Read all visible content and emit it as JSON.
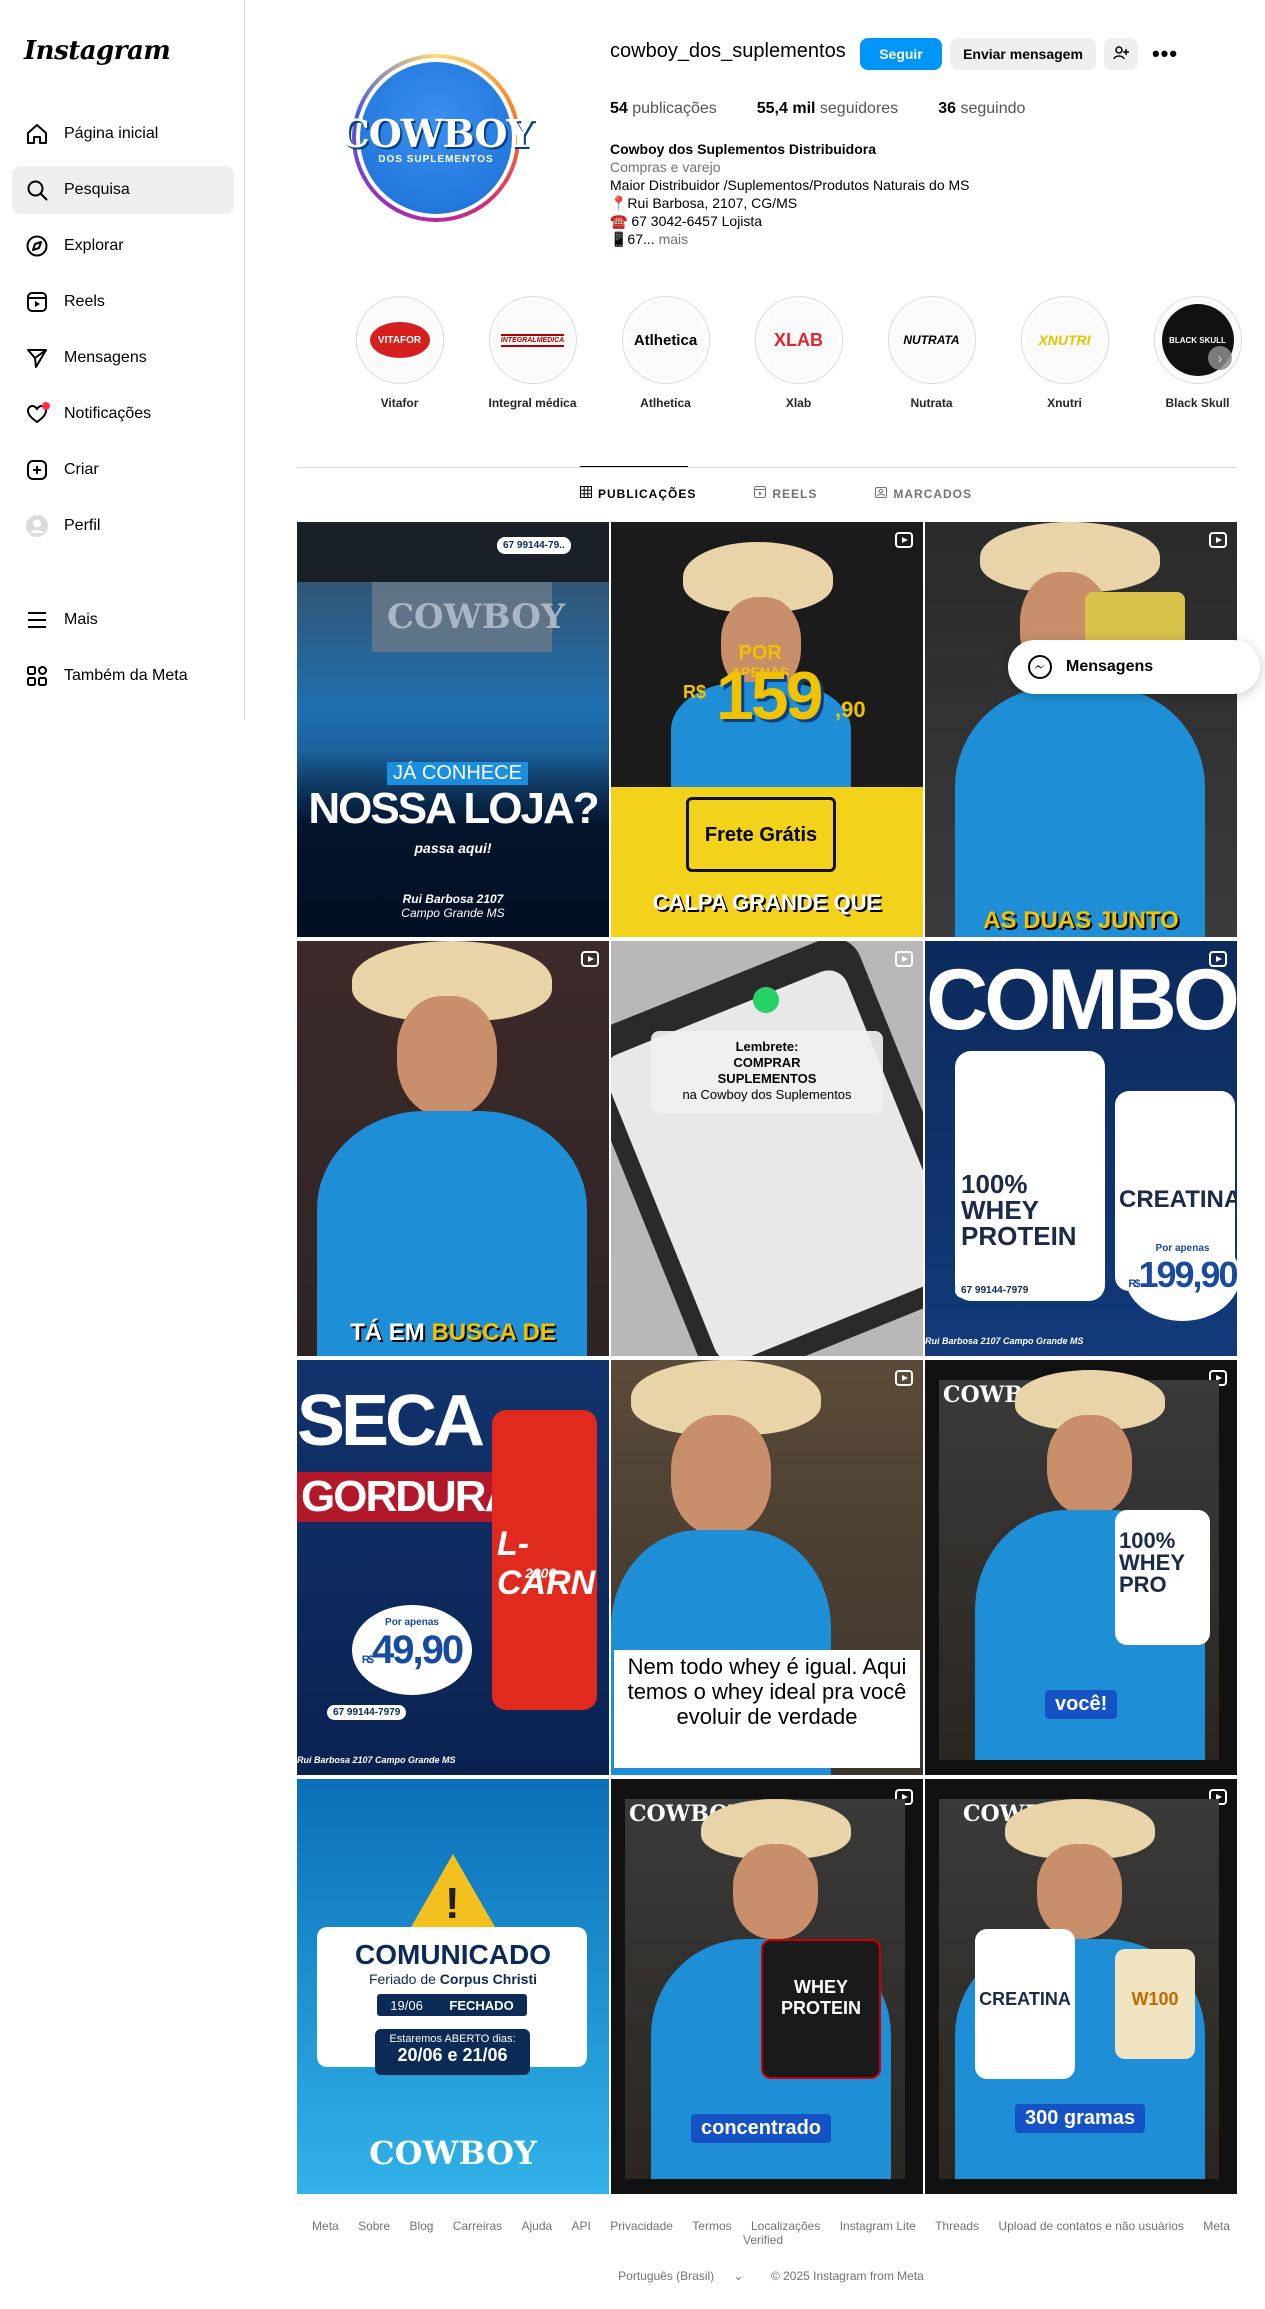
{
  "app": {
    "logo": "Instagram"
  },
  "sidebar": {
    "items": [
      {
        "label": "Página inicial",
        "icon": "home-icon"
      },
      {
        "label": "Pesquisa",
        "icon": "search-icon"
      },
      {
        "label": "Explorar",
        "icon": "compass-icon"
      },
      {
        "label": "Reels",
        "icon": "reels-icon"
      },
      {
        "label": "Mensagens",
        "icon": "send-icon"
      },
      {
        "label": "Notificações",
        "icon": "heart-icon"
      },
      {
        "label": "Criar",
        "icon": "plus-square-icon"
      },
      {
        "label": "Perfil",
        "icon": "profile-avatar-icon"
      }
    ],
    "bottom": [
      {
        "label": "Mais",
        "icon": "menu-icon"
      },
      {
        "label": "Também da Meta",
        "icon": "meta-apps-icon"
      }
    ]
  },
  "profile": {
    "username": "cowboy_dos_suplementos",
    "avatar_text": "COWBOY",
    "avatar_subtext": "DOS SUPLEMENTOS",
    "follow_label": "Seguir",
    "message_label": "Enviar mensagem",
    "more_label": "•••",
    "stats": {
      "posts_value": "54",
      "posts_label": "publicações",
      "followers_value": "55,4 mil",
      "followers_label": "seguidores",
      "following_value": "36",
      "following_label": "seguindo"
    },
    "bio": {
      "name": "Cowboy dos Suplementos Distribuidora",
      "category": "Compras e varejo",
      "line1": "Maior Distribuidor /Suplementos/Produtos Naturais do MS",
      "line2": "📍Rui Barbosa, 2107, CG/MS",
      "line3": "☎️ 67 3042-6457 Lojista",
      "line4": "📱67...",
      "more": " mais"
    }
  },
  "highlights": [
    {
      "label": "Vitafor",
      "logo": "VITAFOR",
      "color": "#d62020"
    },
    {
      "label": "Integral médica",
      "logo": "INTEGRALMEDICA",
      "color": "#b00000"
    },
    {
      "label": "Atlhetica",
      "logo": "Atlhetica",
      "color": "#111111"
    },
    {
      "label": "Xlab",
      "logo": "XLAB",
      "color": "#e0262d"
    },
    {
      "label": "Nutrata",
      "logo": "NUTRATA",
      "color": "#111111"
    },
    {
      "label": "Xnutri",
      "logo": "XNUTRI",
      "color": "#e8c400"
    },
    {
      "label": "Black Skull",
      "logo": "BLACK SKULL",
      "color": "#111111"
    }
  ],
  "tabs": [
    {
      "label": "PUBLICAÇÕES",
      "icon": "grid-icon"
    },
    {
      "label": "REELS",
      "icon": "reels-icon"
    },
    {
      "label": "MARCADOS",
      "icon": "tagged-icon"
    }
  ],
  "posts": {
    "p1": {
      "phone": "67 99144-79..",
      "line1": "JÁ CONHECE",
      "line2": "NOSSA LOJA?",
      "line3": "passa aqui!",
      "line4": "Rui Barbosa 2107",
      "line5": "Campo Grande MS"
    },
    "p2": {
      "por": "POR",
      "apenas": "APENAS",
      "rs": "R$",
      "price": "159",
      "cents": ",90",
      "frete": "Frete Grátis",
      "city": "CALPA GRANDE QUE"
    },
    "p3": {
      "caption": "AS DUAS JUNTO"
    },
    "p4": {
      "caption1": "TÁ EM ",
      "caption2": "BUSCA DE"
    },
    "p5": {
      "l1": "Lembrete:",
      "l2": "COMPRAR",
      "l3": "SUPLEMENTOS",
      "l4": "na Cowboy dos Suplementos"
    },
    "p6": {
      "title": "COMBO",
      "whey": "100% WHEY PROTEIN",
      "creatina": "CREATINA",
      "por": "Por apenas",
      "rs": "R$",
      "price": "199,90",
      "phone": "67 99144-7979",
      "addr": "Rui Barbosa 2107 Campo Grande MS"
    },
    "p7": {
      "t1": "SECA",
      "t2": "GORDURA",
      "prod": "L-CARN",
      "prod2": "2000",
      "por": "Por apenas",
      "rs": "R$",
      "price": "49,90",
      "phone": "67 99144-7979",
      "addr": "Rui Barbosa 2107 Campo Grande MS"
    },
    "p8": {
      "caption": "Nem todo whey é igual. Aqui temos o whey ideal pra você evoluir de verdade"
    },
    "p9": {
      "brand": "COWBOY",
      "prod": "100% WHEY PRO",
      "caption": "você!"
    },
    "p10": {
      "title": "COMUNICADO",
      "sub1": "Feriado de ",
      "sub2": "Corpus Christi",
      "date": "19/06",
      "closed": "FECHADO",
      "open": "Estaremos ABERTO dias:",
      "dates": "20/06 e 21/06",
      "brand": "COWBOY"
    },
    "p11": {
      "brand": "COWBOY",
      "prod": "WHEY PROTEIN",
      "caption": "concentrado"
    },
    "p12": {
      "brand": "COWBOY",
      "prod": "CREATINA",
      "prod2": "W100",
      "caption": "300 gramas"
    }
  },
  "floating": {
    "messages_label": "Mensagens"
  },
  "footer": {
    "links": [
      "Meta",
      "Sobre",
      "Blog",
      "Carreiras",
      "Ajuda",
      "API",
      "Privacidade",
      "Termos",
      "Localizações",
      "Instagram Lite",
      "Threads",
      "Upload de contatos e não usuários",
      "Meta Verified"
    ],
    "language": "Português (Brasil)",
    "copyright": "© 2025 Instagram from Meta"
  }
}
